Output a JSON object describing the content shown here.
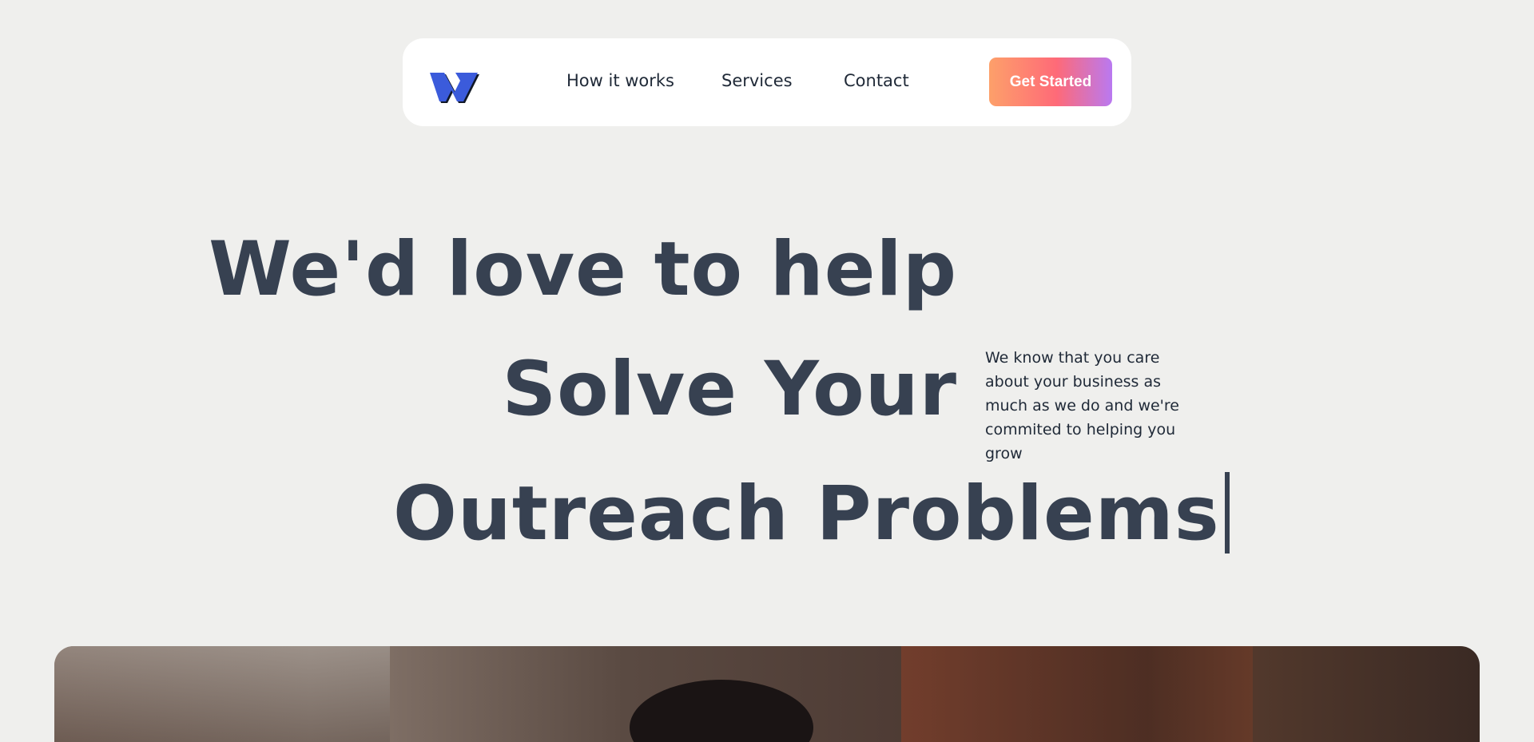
{
  "nav": {
    "logo_icon": "w-logo-icon",
    "links": [
      "How it works",
      "Services",
      "Contact"
    ],
    "cta_label": "Get Started"
  },
  "hero": {
    "line1": "We'd love to help",
    "line2": "Solve Your",
    "line3": "Outreach Problems",
    "subtext": "We know that you care about your business as much as we do and we're commited to helping you grow"
  },
  "colors": {
    "background": "#efefed",
    "heading": "#374151",
    "logo": "#3b5bdb",
    "cta_gradient": [
      "#fda06a",
      "#fe6a78",
      "#b979f1"
    ]
  }
}
